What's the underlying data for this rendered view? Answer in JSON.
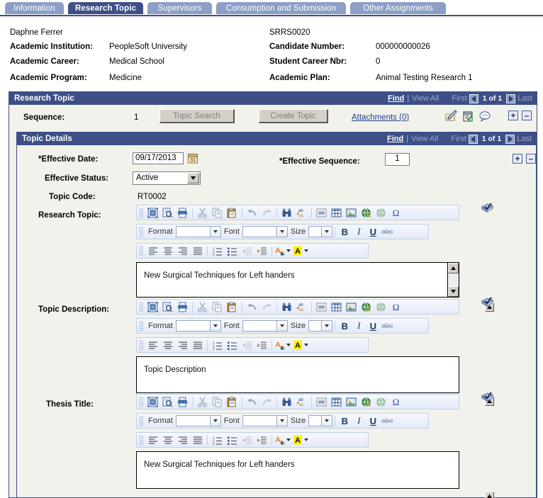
{
  "tabs": [
    {
      "label": "Information",
      "active": false
    },
    {
      "label": "Research Topic",
      "active": true
    },
    {
      "label": "Supervisors",
      "active": false
    },
    {
      "label": "Consumption and Submission",
      "active": false
    },
    {
      "label": "Other Assignments",
      "active": false
    }
  ],
  "header": {
    "student_name": "Daphne Ferrer",
    "record_id": "SRRS0020",
    "left_fields": [
      {
        "label": "Academic Institution:",
        "value": "PeopleSoft University"
      },
      {
        "label": "Academic Career:",
        "value": "Medical School"
      },
      {
        "label": "Academic Program:",
        "value": "Medicine"
      }
    ],
    "right_fields": [
      {
        "label": "Candidate Number:",
        "value": "000000000026"
      },
      {
        "label": "Student Career Nbr:",
        "value": "0"
      },
      {
        "label": "Academic Plan:",
        "value": "Animal Testing Research 1"
      }
    ]
  },
  "research_topic": {
    "title": "Research Topic",
    "nav": {
      "find": "Find",
      "separator": "|",
      "view_all": "View All",
      "first": "First",
      "count": "1 of 1",
      "last": "Last",
      "prev_icon": "left-arrow-icon",
      "next_icon": "right-arrow-icon"
    },
    "sequence_label": "Sequence:",
    "sequence_value": "1",
    "topic_search_button": "Topic Search",
    "create_topic_button": "Create Topic",
    "attachments_link": "Attachments (0)",
    "row_icons": [
      {
        "name": "notes-pen-icon"
      },
      {
        "name": "checklist-icon"
      },
      {
        "name": "comment-bubble-icon"
      }
    ],
    "add_row_button": "+",
    "delete_row_button": "–"
  },
  "topic_details": {
    "title": "Topic Details",
    "nav": {
      "find": "Find",
      "separator": "|",
      "view_all": "View All",
      "first": "First",
      "count": "1 of 1",
      "last": "Last"
    },
    "effective_date_label": "*Effective Date:",
    "effective_date_value": "09/17/2013",
    "calendar_icon": "calendar-icon",
    "effective_sequence_label": "*Effective Sequence:",
    "effective_sequence_value": "1",
    "effective_status_label": "Effective Status:",
    "effective_status_value": "Active",
    "topic_code_label": "Topic Code:",
    "topic_code_value": "RT0002",
    "add_row_button": "+",
    "delete_row_button": "–"
  },
  "editors": [
    {
      "label": "Research Topic:",
      "content": "New Surgical Techniques for Left handers",
      "has_scrollbar": true
    },
    {
      "label": "Topic Description:",
      "content": "Topic Description",
      "has_scrollbar": false
    },
    {
      "label": "Thesis Title:",
      "content": "New Surgical Techniques for Left handers",
      "has_scrollbar": false
    }
  ],
  "toolbar": {
    "row1_icons": [
      {
        "name": "maximize-editor-icon"
      },
      {
        "name": "preview-icon"
      },
      {
        "name": "print-icon"
      },
      {
        "name": "cut-icon"
      },
      {
        "name": "copy-icon"
      },
      {
        "name": "paste-icon"
      },
      {
        "name": "undo-icon"
      },
      {
        "name": "redo-icon"
      },
      {
        "name": "find-binoculars-icon"
      },
      {
        "name": "replace-icon"
      },
      {
        "name": "horizontal-rule-icon"
      },
      {
        "name": "insert-table-icon"
      },
      {
        "name": "insert-image-icon"
      },
      {
        "name": "insert-link-icon"
      },
      {
        "name": "remove-link-icon"
      },
      {
        "name": "special-character-icon"
      }
    ],
    "format_label": "Format",
    "font_label": "Font",
    "size_label": "Size",
    "format_value": "",
    "font_value": "",
    "size_value": "",
    "bold_label": "B",
    "italic_label": "I",
    "underline_label": "U",
    "strike_label": "abc",
    "row3_icons": [
      {
        "name": "align-left-icon"
      },
      {
        "name": "align-center-icon"
      },
      {
        "name": "align-right-icon"
      },
      {
        "name": "align-justify-icon"
      },
      {
        "name": "numbered-list-icon"
      },
      {
        "name": "bullet-list-icon"
      },
      {
        "name": "outdent-icon"
      },
      {
        "name": "indent-icon"
      },
      {
        "name": "text-color-icon"
      },
      {
        "name": "background-color-icon"
      }
    ],
    "spell_check_icon": "spell-check-icon"
  },
  "colors": {
    "header_navy": "#3d4f86",
    "tab_inactive": "#8c9fc6",
    "panel_bg": "#f1f2ec",
    "link_blue": "#204090",
    "toolbar_blue": "#e3eaf8"
  }
}
